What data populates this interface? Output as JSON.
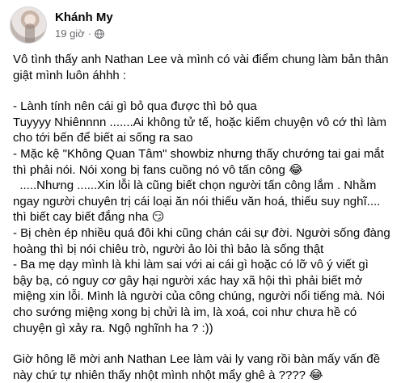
{
  "post": {
    "author": "Khánh My",
    "time": "19 giờ",
    "separator": "·",
    "privacy_icon": "globe-icon",
    "paragraphs": [
      "Vô tình thấy anh Nathan Lee và mình có vài điểm chung làm bản thân giật mình luôn áhhh :",
      "- Lành tính nên cái gì bỏ qua được thì bỏ qua\nTuyyyy Nhiênnnn .......Ai không tử tế, hoặc kiếm chuyện vô cớ thì làm cho tới bến để biết ai sống ra sao\n- Mặc kệ \"Không Quan Tâm\" showbiz nhưng thấy chướng tai gai mắt thì phải nói. Nói xong bị fans cuồng nó vô tấn công 😂\n  .....Nhưng ......Xin lỗi là cũng biết chọn người tấn công lắm . Nhằm ngay người chuyên trị cái loại ăn nói thiếu văn hoá, thiếu suy nghĩ.... thì biết cay biết đắng nha 😏\n- Bị chèn ép nhiều quá đôi khi cũng chán cái sự đời. Người sống đàng hoàng thì bị nói chiêu trò, người ảo lòi thì bảo là sống thật\n- Ba mẹ dạy mình là khi làm sai với ai cái gì hoặc có lỡ vô ý viết gì bậy bạ, có nguy cơ gây hại người xác hay xã hội thì phải biết mở miệng xin lỗi. Mình là người của công chúng, người nổi tiếng mà. Nói cho sướng miệng xong bị chửi là im, là xoá, coi như chưa hề có chuyện gì xảy ra. Ngộ nghĩnh ha ? :))",
      "Giờ hông lẽ mời anh Nathan Lee làm vài ly vang rồi bàn mấy vấn đề này chứ tự nhiên thấy nhột mình nhột mẩy ghê à ???? 😂"
    ]
  }
}
